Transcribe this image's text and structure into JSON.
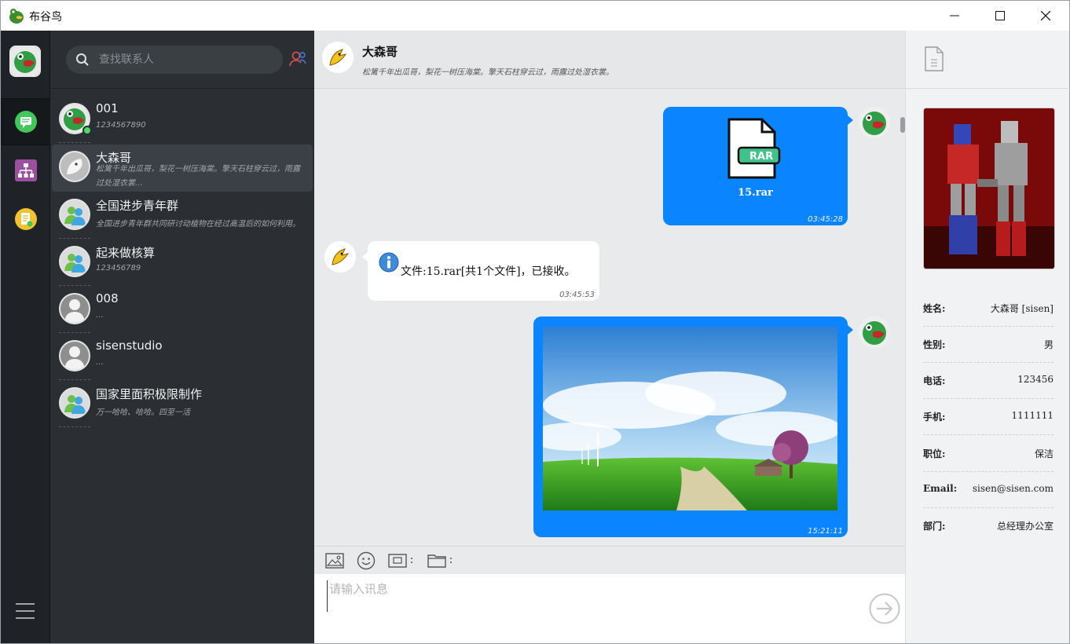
{
  "window": {
    "title": "布谷鸟"
  },
  "search": {
    "placeholder": "查找联系人"
  },
  "contacts": [
    {
      "name": "001",
      "signature": "1234567890",
      "online": true
    },
    {
      "name": "大森哥",
      "signature": "松篱千年出瓜哥，梨花一树压海棠。擎天石柱穿云过，雨露过处湿衣裳…",
      "online": false
    },
    {
      "name": "全国进步青年群",
      "signature": "全国进步青年群共同研讨动植物在经过高温后的如何利用。",
      "online": false
    },
    {
      "name": "起来做核算",
      "signature": "123456789",
      "online": false
    },
    {
      "name": "008",
      "signature": "…",
      "online": false
    },
    {
      "name": "sisenstudio",
      "signature": "…",
      "online": false
    },
    {
      "name": "国家里面积极限制作",
      "signature": "万一哈哈、哈哈。四至一活",
      "online": false
    }
  ],
  "chat": {
    "title": "大森哥",
    "subtitle": "松篱千年出瓜哥，梨花一树压海棠。擎天石柱穿云过，雨露过处湿衣裳。",
    "messages": [
      {
        "direction": "out",
        "type": "file",
        "file_badge": "RAR",
        "file_name": "15.rar",
        "time": "03:45:28"
      },
      {
        "direction": "in",
        "type": "text",
        "text": "文件:15.rar[共1个文件]，已接收。",
        "time": "03:45:53"
      },
      {
        "direction": "out",
        "type": "image",
        "time": "15:21:11"
      }
    ]
  },
  "composer": {
    "placeholder": "请输入讯息"
  },
  "profile": {
    "fields": [
      {
        "key": "姓名:",
        "value": "大森哥 [sisen]"
      },
      {
        "key": "性别:",
        "value": "男"
      },
      {
        "key": "电话:",
        "value": "123456"
      },
      {
        "key": "手机:",
        "value": "1111111"
      },
      {
        "key": "职位:",
        "value": "保洁"
      },
      {
        "key": "Email:",
        "value": "sisen@sisen.com"
      },
      {
        "key": "部门:",
        "value": "总经理办公室"
      }
    ]
  },
  "colors": {
    "accent": "#0a84ff",
    "rail": "#1f2328",
    "contacts_bg": "#2b2f33",
    "online": "#4cd964"
  }
}
